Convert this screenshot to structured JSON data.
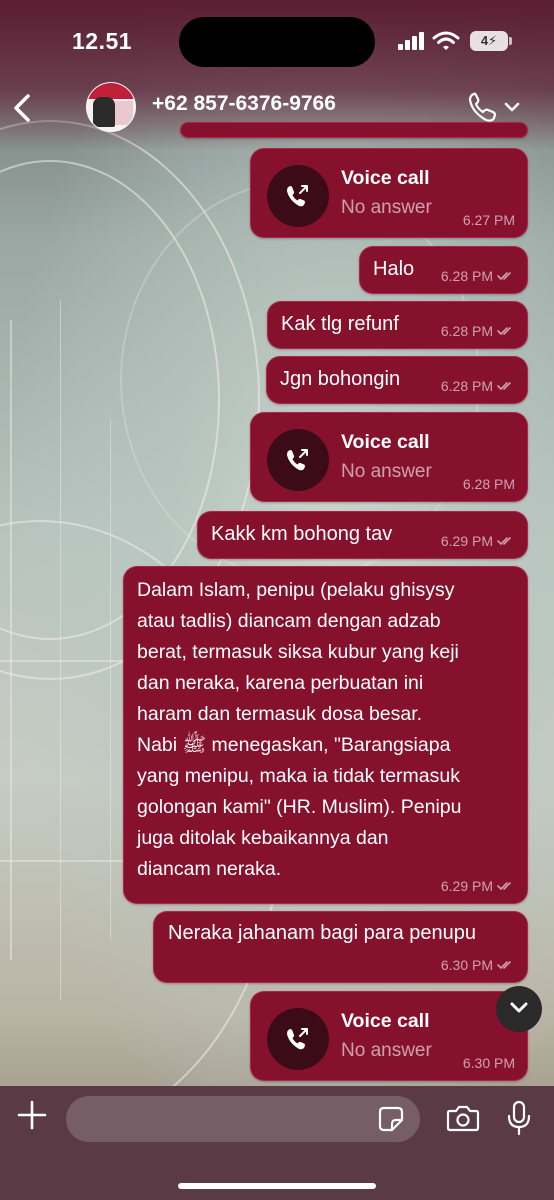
{
  "status_bar": {
    "time": "12.51",
    "battery": "4"
  },
  "header": {
    "contact": "+62 857-6376-9766"
  },
  "messages": [
    {
      "type": "call",
      "title": "Voice call",
      "subtitle": "No answer",
      "time": "6.27 PM"
    },
    {
      "type": "text",
      "text": "Halo",
      "time": "6.28 PM"
    },
    {
      "type": "text",
      "text": "Kak tlg refunf",
      "time": "6.28 PM"
    },
    {
      "type": "text",
      "text": "Jgn bohongin",
      "time": "6.28 PM"
    },
    {
      "type": "call",
      "title": "Voice call",
      "subtitle": "No answer",
      "time": "6.28 PM"
    },
    {
      "type": "text",
      "text": "Kakk km bohong tav",
      "time": "6.29 PM"
    },
    {
      "type": "text",
      "lines": [
        "Dalam Islam, penipu (pelaku ghisysy",
        "atau tadlis) diancam dengan adzab",
        "berat, termasuk siksa kubur yang keji",
        "dan neraka, karena perbuatan ini",
        "haram dan termasuk dosa besar.",
        "Nabi ﷺ menegaskan, \"Barangsiapa",
        "yang menipu, maka ia tidak termasuk",
        "golongan kami\" (HR. Muslim). Penipu",
        "juga ditolak kebaikannya dan",
        "diancam neraka."
      ],
      "time": "6.29 PM"
    },
    {
      "type": "text",
      "text": "Neraka jahanam bagi para penupu",
      "time": "6.30 PM"
    },
    {
      "type": "call",
      "title": "Voice call",
      "subtitle": "No answer",
      "time": "6.30 PM"
    }
  ],
  "input": {
    "placeholder": ""
  },
  "icons": {
    "back": "chevron-left-icon",
    "call": "phone-icon",
    "plus": "plus-icon",
    "sticker": "sticker-icon",
    "camera": "camera-icon",
    "mic": "microphone-icon",
    "scroll": "chevron-down-icon"
  },
  "colors": {
    "bubble": "#86112d",
    "call_icon_bg": "#3b0b18",
    "header_tint": "#5b1e33"
  }
}
